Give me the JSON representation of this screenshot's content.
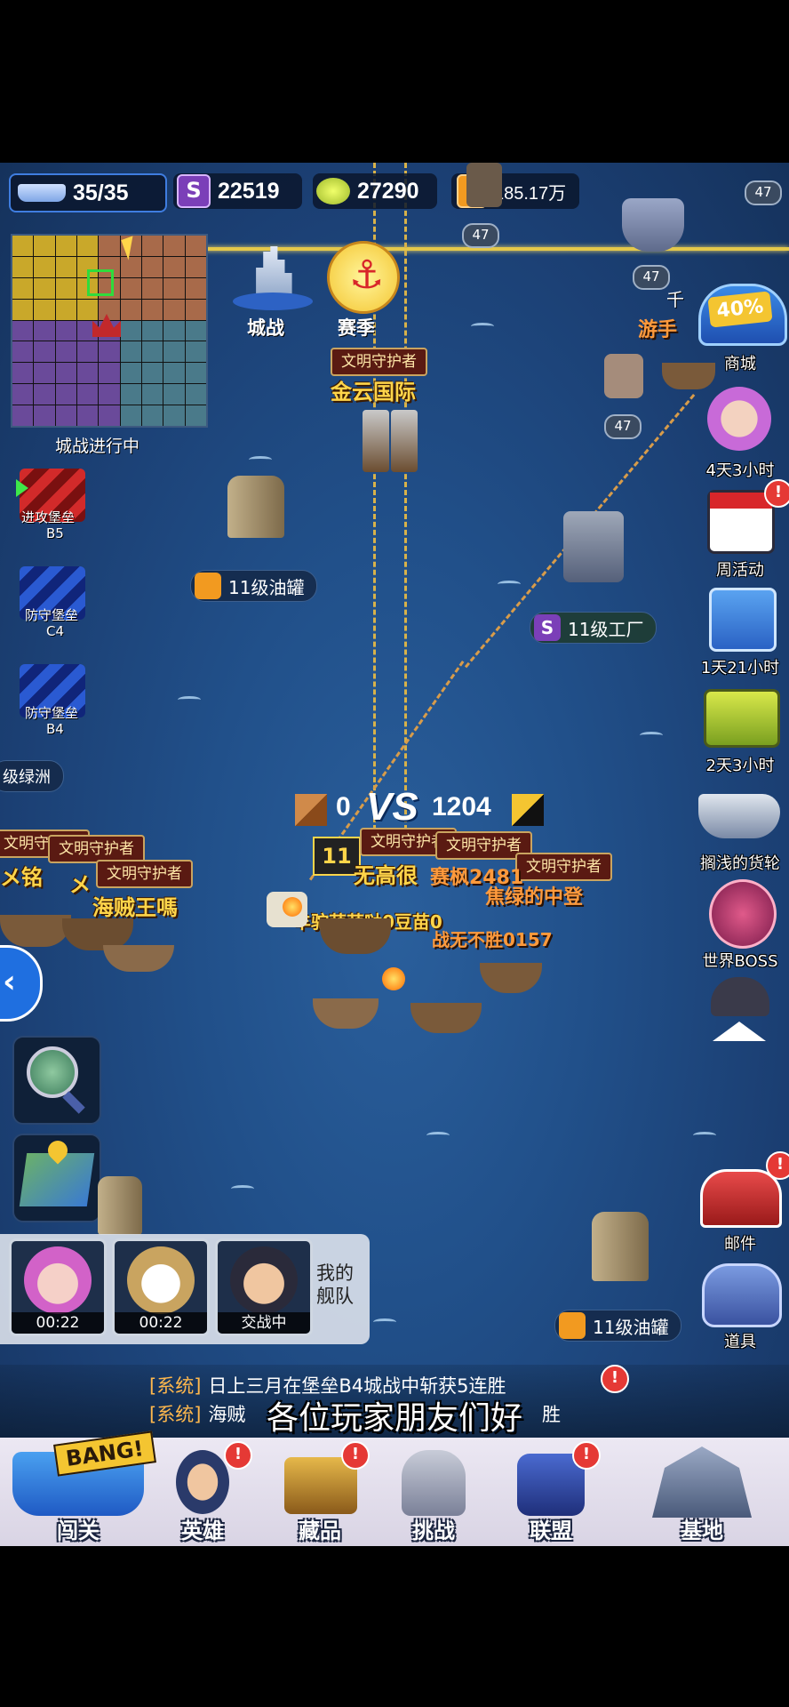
{
  "top_bar": {
    "ships": "35/35",
    "coins_s": "22519",
    "gold": "27290",
    "oil": "185.17万"
  },
  "map_labels": {
    "city_battle": "城战",
    "season": "赛季",
    "city_battle_in_progress": "城战进行中",
    "oil_tank_top": "11级油罐",
    "factory": "11级工厂",
    "oil_tank_bottom": "11级油罐",
    "oasis": "级绿洲",
    "level_47a": "47",
    "level_47b": "47",
    "level_47c": "47",
    "level_47d": "47"
  },
  "fortresses": [
    {
      "label": "进攻堡垒",
      "code": "B5"
    },
    {
      "label": "防守堡垒",
      "code": "C4"
    },
    {
      "label": "防守堡垒",
      "code": "B4"
    }
  ],
  "battle": {
    "left_score": "0",
    "vs": "VS",
    "right_score": "1204",
    "mini_level": "11"
  },
  "guard_title": "文明守护者",
  "players": {
    "jinyun": "金云国际",
    "wujiang": "无高很",
    "saifeng": "赛枫2481",
    "lv": "焦绿的中登",
    "sheep": "羊驼萌萌哒0豆苗0",
    "budong": "战无不胜0157",
    "haizei": "海贼王嗎",
    "memin": "メ铭",
    "me": "メ",
    "youshou": "游手",
    "qian": "千"
  },
  "right_menu": [
    {
      "label": "商城"
    },
    {
      "label": "4天3小时"
    },
    {
      "label": "周活动"
    },
    {
      "label": "1天21小时"
    },
    {
      "label": "2天3小时"
    },
    {
      "label": "搁浅的货轮"
    },
    {
      "label": "世界BOSS"
    },
    {
      "label": "邮件"
    },
    {
      "label": "道具"
    }
  ],
  "shop_badge": "40%",
  "heroes": [
    {
      "time": "00:22"
    },
    {
      "time": "00:22"
    },
    {
      "time": "交战中"
    }
  ],
  "my_fleet": "我的舰队",
  "chat": [
    {
      "tag": "[系统]",
      "text": "日上三月在堡垒B4城战中斩获5连胜"
    },
    {
      "tag": "[系统]",
      "text": "海贼"
    },
    {
      "tag": "",
      "text": "胜"
    }
  ],
  "subtitle": "各位玩家朋友们好",
  "bottom_nav": [
    {
      "label": "闯关",
      "badge": "BANG!"
    },
    {
      "label": "英雄"
    },
    {
      "label": "藏品"
    },
    {
      "label": "挑战"
    },
    {
      "label": "联盟"
    },
    {
      "label": "基地"
    }
  ],
  "colors": {
    "ocean": "#21508a",
    "gold_text": "#ffd54a",
    "alert_red": "#e53935",
    "system_tag": "#ffb84d"
  }
}
